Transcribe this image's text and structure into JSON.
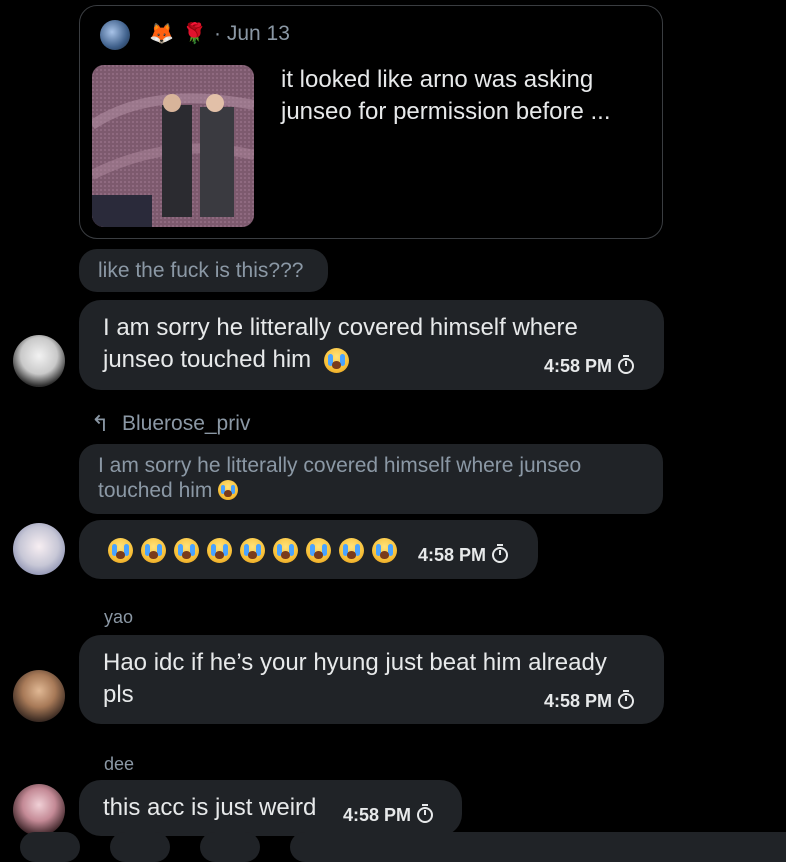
{
  "quote": {
    "date": "· Jun 13",
    "text": "it looked like arno was asking junseo for permission before ...",
    "emojis": [
      "🦊",
      "🌹"
    ]
  },
  "reply_chip_1": "like the fuck is this???",
  "messages": [
    {
      "text": "I am sorry he litterally covered himself where junseo touched him",
      "time": "4:58 PM"
    },
    {
      "reply_to_user": "Bluerose_priv",
      "reply_quote": "I am sorry he litterally covered himself where junseo touched him",
      "time": "4:58 PM",
      "emoji_count": 9
    },
    {
      "sender": "yao",
      "text": "Hao idc if he’s your hyung just beat him already pls",
      "time": "4:58 PM"
    },
    {
      "sender": "dee",
      "text": "this acc is just weird",
      "time": "4:58 PM"
    }
  ],
  "icons": {
    "timer": "timer-icon",
    "reply": "reply-arrow-icon",
    "cry": "loudly-crying-face-emoji"
  }
}
